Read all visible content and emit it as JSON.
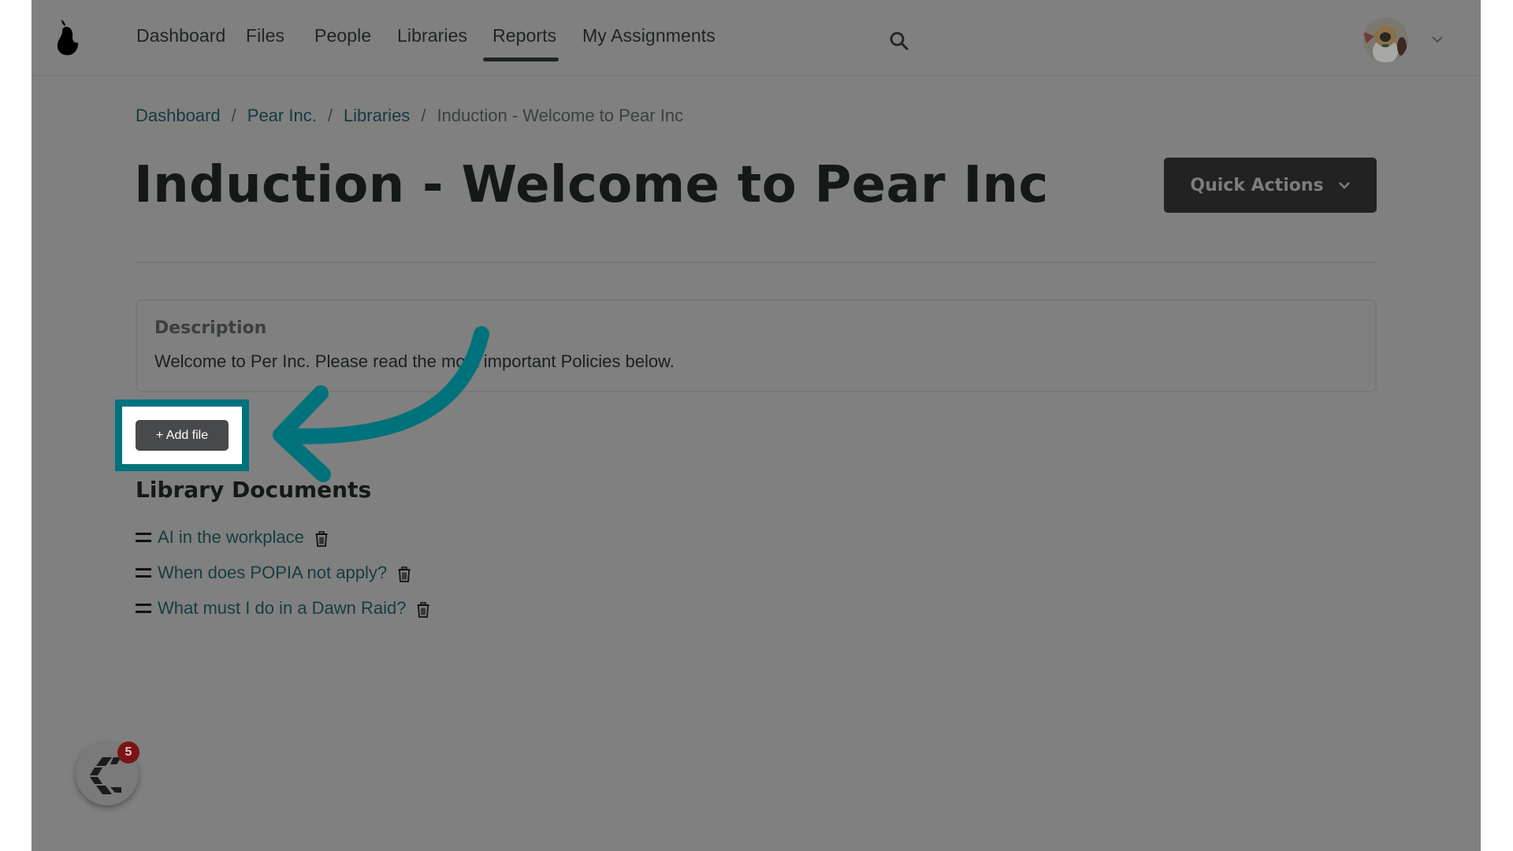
{
  "header": {
    "logo": "pear-logo",
    "nav": [
      {
        "label": "Dashboard",
        "active": false
      },
      {
        "label": "Files",
        "active": false
      },
      {
        "label": "People",
        "active": false
      },
      {
        "label": "Libraries",
        "active": true
      },
      {
        "label": "Reports",
        "active": false
      },
      {
        "label": "My Assignments",
        "active": false
      }
    ],
    "search_icon": "search-icon",
    "user_menu_icon": "chevron-down-icon"
  },
  "breadcrumb": [
    {
      "label": "Dashboard",
      "link": true
    },
    {
      "label": "Pear Inc.",
      "link": true
    },
    {
      "label": "Libraries",
      "link": true
    },
    {
      "label": "Induction - Welcome to Pear Inc",
      "link": false
    }
  ],
  "breadcrumb_separator": "/",
  "page": {
    "title": "Induction - Welcome to Pear Inc",
    "quick_actions_label": "Quick Actions"
  },
  "description": {
    "label": "Description",
    "text": "Welcome to Per Inc. Please read the most important Policies below."
  },
  "add_file_label": "+ Add file",
  "library": {
    "title": "Library Documents",
    "documents": [
      {
        "title": "AI in the workplace"
      },
      {
        "title": "When does POPIA not apply?"
      },
      {
        "title": "What must I do in a Dawn Raid?"
      }
    ]
  },
  "chat_widget": {
    "badge_count": "5"
  },
  "annotation": {
    "highlight_color": "#00727c",
    "target": "add-file-button"
  }
}
